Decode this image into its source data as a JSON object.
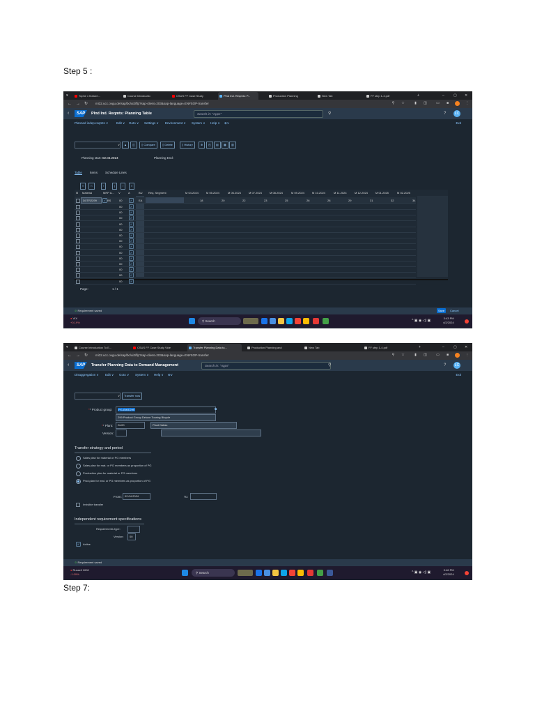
{
  "steps": {
    "step5": "Step 5 :",
    "step7": "Step 7:"
  },
  "shot1": {
    "tabs": [
      {
        "label": "Tophe x feature...",
        "color": "#ff0000"
      },
      {
        "label": "Course Introductio",
        "color": "#cccccc"
      },
      {
        "label": "CSUS FF Case Study",
        "color": "#ff0000"
      },
      {
        "label": "Plnd Ind. Reqmts: P...",
        "color": "#5ab3f5"
      },
      {
        "label": "Production Planning",
        "color": "#cccccc"
      },
      {
        "label": "New Tab",
        "color": "#cccccc"
      },
      {
        "label": "FF step 1-4.pdf",
        "color": "#cccccc"
      }
    ],
    "url": "mi32.ucc.ovgu.de/sap/bc/ui2/flp?sap-client=203&sap-language=EN#SOP-transfer",
    "app_title": "Plnd Ind. Reqmts: Planning Table",
    "search_placeholder": "Search in: \"Apps\"",
    "avatar": "LC",
    "menus": [
      "Planned indep.reqmts ∨",
      "Edit ∨",
      "Goto ∨",
      "Settings ∨",
      "Environment ∨",
      "System ∨",
      "Help ∨",
      "⊕∨"
    ],
    "exit": "Exit",
    "toolbar_buttons": [
      "Compare",
      "Delete",
      "History"
    ],
    "planning_start_label": "Planning start:",
    "planning_start_value": "02.04.2024",
    "planning_end_label": "Planning End:",
    "subtabs": [
      "Table",
      "Items",
      "Schedule Lines"
    ],
    "columns": [
      "Material",
      "MRP A...",
      "V",
      "A",
      "BU",
      "Req. Segment",
      "M 04.2024",
      "M 05.2024",
      "M 06.2024",
      "M 07.2024",
      "M 08.2024",
      "M 09.2024",
      "M 10.2024",
      "M 11.2024",
      "M 12.2024",
      "M 01.2025",
      "M 02.2025"
    ],
    "first_row": {
      "material": "DXTR2299",
      "mrp": "BS",
      "v": "00",
      "bu": "EA",
      "values": [
        "18",
        "20",
        "22",
        "23",
        "25",
        "26",
        "28",
        "29",
        "31",
        "32",
        "34"
      ]
    },
    "row_v_values": [
      "00",
      "00",
      "00",
      "00",
      "00",
      "00",
      "00",
      "00",
      "00",
      "00",
      "00",
      "00",
      "00",
      "00"
    ],
    "page_label": "Page:",
    "page_value": "1 / 1",
    "status": "Requirement saved",
    "save": "Save",
    "cancel": "Cancel",
    "weather": "VIX",
    "weather_sub": "+0.19%",
    "taskbar_search": "Search",
    "clock_time": "3:43 PM",
    "clock_date": "4/2/2024"
  },
  "shot2": {
    "tabs": [
      {
        "label": "Course Introduction To E...",
        "color": "#cccccc"
      },
      {
        "label": "CSUS FF Case Study Vide",
        "color": "#ff0000"
      },
      {
        "label": "Transfer Planning Data to...",
        "color": "#5ab3f5"
      },
      {
        "label": "Production Planning and",
        "color": "#cccccc"
      },
      {
        "label": "New Tab",
        "color": "#cccccc"
      },
      {
        "label": "FF step 1-4.pdf",
        "color": "#cccccc"
      }
    ],
    "url": "mi32.ucc.ovgu.de/sap/bc/ui2/flp?sap-client=203&sap-language=EN#SOP-transfer",
    "app_title": "Transfer Planning Data to Demand Management",
    "search_placeholder": "Search in: \"Apps\"",
    "avatar": "LC",
    "menus": [
      "Disaggregation ∨",
      "Edit ∨",
      "Goto ∨",
      "System ∨",
      "Help ∨",
      "⊕∨"
    ],
    "exit": "Exit",
    "transfer_now": "Transfer now",
    "product_group_label": "* Product group:",
    "product_group_value": "PG-BIKE299",
    "product_group_desc": "299 Product Group Deluxe Touring Bicycle",
    "plant_label": "* Plant:",
    "plant_value": "DL00",
    "plant_desc": "Plant Dallas",
    "version_label": "Version:",
    "section1": "Transfer strategy and period",
    "radios": [
      {
        "label": "Sales plan for material or PG members",
        "selected": false
      },
      {
        "label": "Sales plan for mat. or PG members as proportion of PG",
        "selected": false
      },
      {
        "label": "Production plan for material or PG members",
        "selected": false
      },
      {
        "label": "Prod.plan for mat. or PG members as proportion of PG",
        "selected": true
      }
    ],
    "from_label": "From:",
    "from_value": "02.04.2024",
    "to_label": "To:",
    "invisible_transfer": "Invisible transfer",
    "section2": "Independent requirement specifications",
    "req_type_label": "Requirements type:",
    "version2_label": "Version:",
    "version2_value": "00",
    "active_label": "Active",
    "status": "Requirement saved",
    "weather": "Russell 1000",
    "weather_sub": "-1.09%",
    "taskbar_search": "Search",
    "clock_time": "3:46 PM",
    "clock_date": "4/2/2024"
  }
}
